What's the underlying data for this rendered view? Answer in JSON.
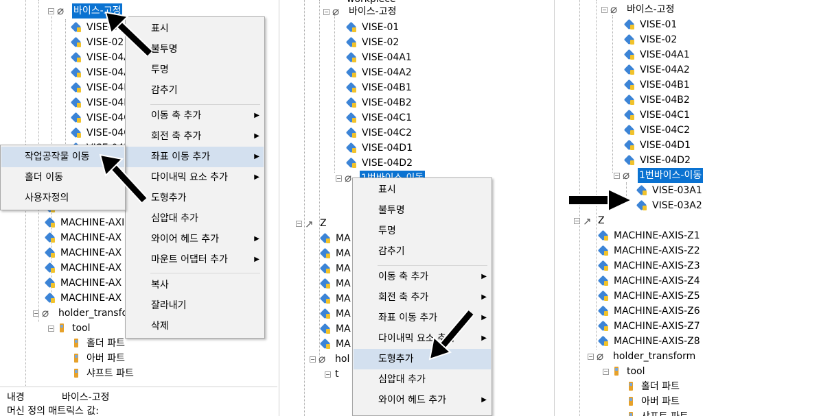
{
  "panel1": {
    "group_label": "바이스-고정",
    "vise_items": [
      "VISE-01",
      "VISE-02",
      "VISE-04A",
      "VISE-04A",
      "VISE-04B",
      "VISE-04B",
      "VISE-04C",
      "VISE-04C",
      "VISE-04D"
    ],
    "machine_items": [
      "MACHINE-AX",
      "MACHINE-AXIS",
      "MACHINE-AX",
      "MACHINE-AX",
      "MACHINE-AX",
      "MACHINE-AX",
      "MACHINE-AX"
    ],
    "holder_transform": "holder_transfo",
    "tool": "tool",
    "tool_parts": [
      "홀더 파트",
      "아버 파트",
      "샤프트 파트"
    ],
    "status_name_key": "내경",
    "status_name_value": "바이스-고정",
    "status_matrix": "머신 정의 매트릭스 값:",
    "context_menu": {
      "items": [
        "표시",
        "불투명",
        "투명",
        "감추기",
        "이동 축 추가",
        "회전 축 추가",
        "좌표 이동 추가",
        "다이내믹 요소 추가",
        "도형추가",
        "심압대 추가",
        "와이어 헤드 추가",
        "마운트 어댑터 추가",
        "복사",
        "잘라내기",
        "삭제"
      ]
    },
    "submenu": {
      "items": [
        "작업공작물 이동",
        "홀더 이동",
        "사용자정의"
      ]
    }
  },
  "panel2": {
    "top_partial": "workpiece",
    "group_label": "바이스-고정",
    "vise_items": [
      "VISE-01",
      "VISE-02",
      "VISE-04A1",
      "VISE-04A2",
      "VISE-04B1",
      "VISE-04B2",
      "VISE-04C1",
      "VISE-04C2",
      "VISE-04D1",
      "VISE-04D2"
    ],
    "selected_group": "1번바이스-이동",
    "z_axis": "Z",
    "machine_items": [
      "MA",
      "MA",
      "MA",
      "MA",
      "MA",
      "MA",
      "MA",
      "MA"
    ],
    "holder_transform": "hol",
    "tool": "t",
    "context_menu": {
      "items": [
        "표시",
        "불투명",
        "투명",
        "감추기",
        "이동 축 추가",
        "회전 축 추가",
        "좌표 이동 추가",
        "다이내믹 요소 추가",
        "도형추가",
        "심압대 추가",
        "와이어 헤드 추가"
      ]
    }
  },
  "panel3": {
    "group_label": "바이스-고정",
    "vise_items": [
      "VISE-01",
      "VISE-02",
      "VISE-04A1",
      "VISE-04A2",
      "VISE-04B1",
      "VISE-04B2",
      "VISE-04C1",
      "VISE-04C2",
      "VISE-04D1",
      "VISE-04D2"
    ],
    "selected_group": "1번바이스-이동",
    "moved_items": [
      "VISE-03A1",
      "VISE-03A2"
    ],
    "z_axis": "Z",
    "machine_items": [
      "MACHINE-AXIS-Z1",
      "MACHINE-AXIS-Z2",
      "MACHINE-AXIS-Z3",
      "MACHINE-AXIS-Z4",
      "MACHINE-AXIS-Z5",
      "MACHINE-AXIS-Z6",
      "MACHINE-AXIS-Z7",
      "MACHINE-AXIS-Z8"
    ],
    "holder_transform": "holder_transform",
    "tool": "tool",
    "tool_parts": [
      "홀더 파트",
      "아버 파트",
      "샤프트 파트"
    ]
  },
  "colors": {
    "selection": "#0a72d1",
    "menu_highlight": "#d3e0ef",
    "menu_bg": "#f2f2f2"
  }
}
